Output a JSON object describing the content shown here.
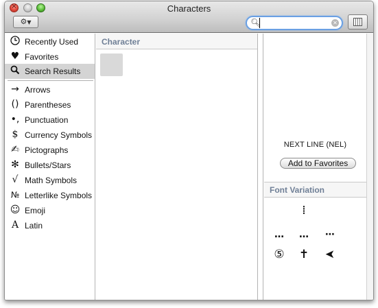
{
  "window": {
    "title": "Characters"
  },
  "toolbar": {
    "action_menu_icon": "gear-icon",
    "search": {
      "value": "",
      "placeholder": ""
    },
    "keyboard_viewer_icon": "keyboard-viewer-icon"
  },
  "sidebar": {
    "items": [
      {
        "label": "Recently Used",
        "icon": "clock-icon",
        "glyph": "◷"
      },
      {
        "label": "Favorites",
        "icon": "heart-icon",
        "glyph": "♥"
      },
      {
        "label": "Search Results",
        "icon": "magnifier-icon",
        "glyph": "🔍",
        "selected": true
      },
      {
        "label": "Arrows",
        "icon": "arrow-icon",
        "glyph": "→"
      },
      {
        "label": "Parentheses",
        "icon": "parentheses-icon",
        "glyph": "( )"
      },
      {
        "label": "Punctuation",
        "icon": "punctuation-icon",
        "glyph": "•,"
      },
      {
        "label": "Currency Symbols",
        "icon": "dollar-icon",
        "glyph": "$"
      },
      {
        "label": "Pictographs",
        "icon": "pictograph-icon",
        "glyph": "✍"
      },
      {
        "label": "Bullets/Stars",
        "icon": "asterisk-icon",
        "glyph": "✻"
      },
      {
        "label": "Math Symbols",
        "icon": "square-root-icon",
        "glyph": "√"
      },
      {
        "label": "Letterlike Symbols",
        "icon": "numero-icon",
        "glyph": "№"
      },
      {
        "label": "Emoji",
        "icon": "smiley-icon",
        "glyph": "☺"
      },
      {
        "label": "Latin",
        "icon": "latin-a-icon",
        "glyph": "A"
      }
    ]
  },
  "character_list": {
    "header": "Character"
  },
  "preview": {
    "character_name": "NEXT LINE (NEL)",
    "add_favorites_label": "Add to Favorites"
  },
  "font_variation": {
    "header": "Font Variation",
    "glyphs": [
      "⁞",
      "…",
      "…",
      "⋯",
      "⑤",
      "✝",
      "➤"
    ]
  }
}
